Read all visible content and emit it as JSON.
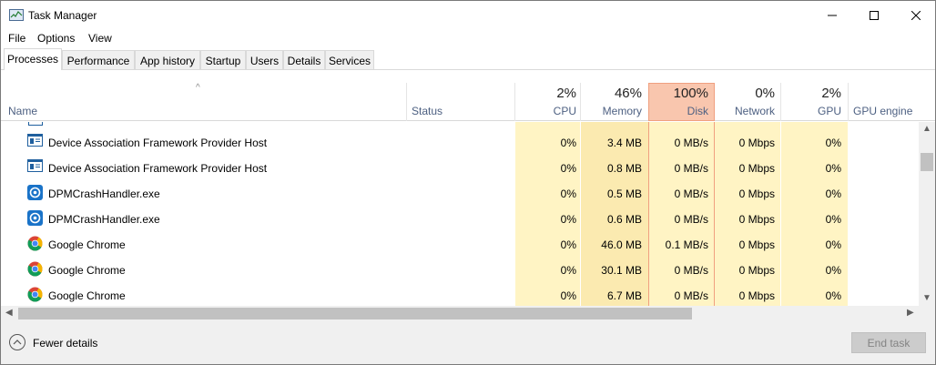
{
  "window": {
    "title": "Task Manager",
    "icons": {
      "app": "task-manager-icon",
      "minimize": "minimize-icon",
      "maximize": "maximize-icon",
      "close": "close-icon"
    }
  },
  "menu": {
    "file": "File",
    "options": "Options",
    "view": "View"
  },
  "tabs": {
    "processes": "Processes",
    "performance": "Performance",
    "app_history": "App history",
    "startup": "Startup",
    "users": "Users",
    "details": "Details",
    "services": "Services",
    "active": "Processes"
  },
  "header": {
    "name": "Name",
    "status": "Status",
    "cpu": {
      "percent": "2%",
      "label": "CPU"
    },
    "memory": {
      "percent": "46%",
      "label": "Memory"
    },
    "disk": {
      "percent": "100%",
      "label": "Disk"
    },
    "network": {
      "percent": "0%",
      "label": "Network"
    },
    "gpu": {
      "percent": "2%",
      "label": "GPU"
    },
    "gpu_engine": "GPU engine",
    "sort_indicator": "^"
  },
  "rows": [
    {
      "name": "Device Association Framework Provider Host",
      "icon": "service-host-icon",
      "cpu": "0%",
      "memory": "3.4 MB",
      "disk": "0 MB/s",
      "network": "0 Mbps",
      "gpu": "0%"
    },
    {
      "name": "Device Association Framework Provider Host",
      "icon": "service-host-icon",
      "cpu": "0%",
      "memory": "0.8 MB",
      "disk": "0 MB/s",
      "network": "0 Mbps",
      "gpu": "0%"
    },
    {
      "name": "DPMCrashHandler.exe",
      "icon": "crash-handler-icon",
      "cpu": "0%",
      "memory": "0.5 MB",
      "disk": "0 MB/s",
      "network": "0 Mbps",
      "gpu": "0%"
    },
    {
      "name": "DPMCrashHandler.exe",
      "icon": "crash-handler-icon",
      "cpu": "0%",
      "memory": "0.6 MB",
      "disk": "0 MB/s",
      "network": "0 Mbps",
      "gpu": "0%"
    },
    {
      "name": "Google Chrome",
      "icon": "chrome-icon",
      "cpu": "0%",
      "memory": "46.0 MB",
      "disk": "0.1 MB/s",
      "network": "0 Mbps",
      "gpu": "0%"
    },
    {
      "name": "Google Chrome",
      "icon": "chrome-icon",
      "cpu": "0%",
      "memory": "30.1 MB",
      "disk": "0 MB/s",
      "network": "0 Mbps",
      "gpu": "0%"
    },
    {
      "name": "Google Chrome",
      "icon": "chrome-icon",
      "cpu": "0%",
      "memory": "6.7 MB",
      "disk": "0 MB/s",
      "network": "0 Mbps",
      "gpu": "0%"
    }
  ],
  "footer": {
    "fewer_details": "Fewer details",
    "end_task": "End task"
  },
  "colors": {
    "heat_light": "#fff4c4",
    "heat_memory": "#fbeab0",
    "disk_header": "#f9c6ae",
    "header_label": "#4d6082"
  }
}
